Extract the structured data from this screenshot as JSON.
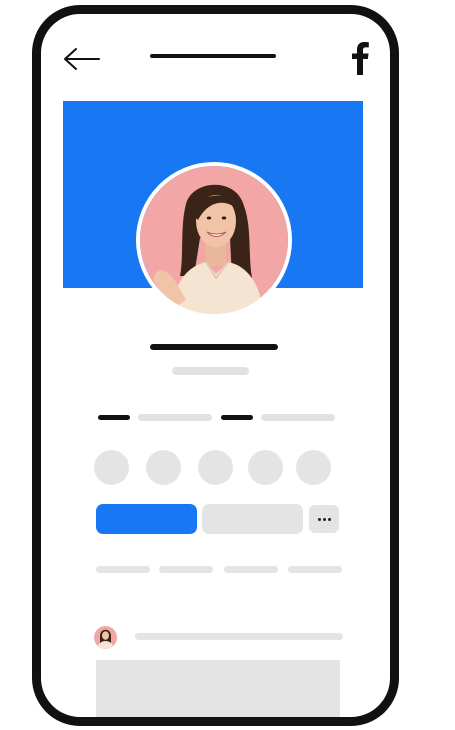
{
  "colors": {
    "brand_blue": "#1877f2",
    "placeholder_gray": "#e4e4e4",
    "frame": "#111111",
    "avatar_bg": "#f0a3a3"
  },
  "header": {
    "back_icon": "arrow-left-icon",
    "brand_icon": "facebook-f-icon"
  },
  "profile": {
    "cover_color": "#1877f2",
    "avatar_icon": "profile-photo"
  },
  "actions": {
    "more_icon": "ellipsis-icon"
  }
}
